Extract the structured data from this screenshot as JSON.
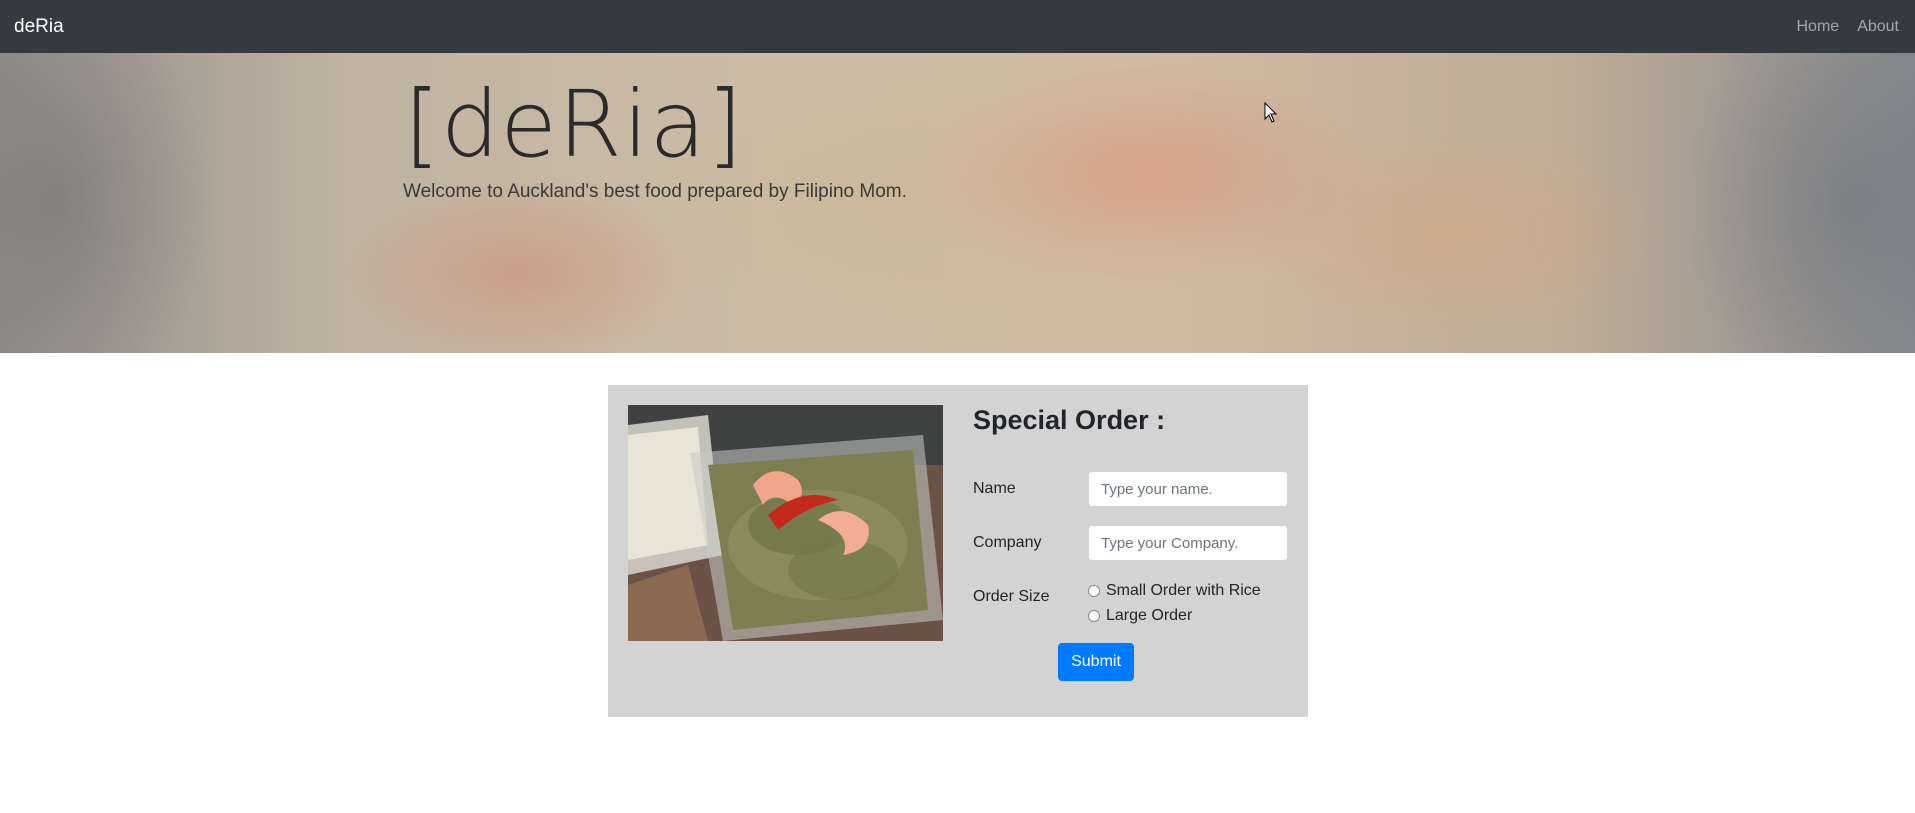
{
  "navbar": {
    "brand": "deRia",
    "links": [
      {
        "label": "Home"
      },
      {
        "label": "About"
      }
    ]
  },
  "hero": {
    "title": "[deRia]",
    "subtitle": "Welcome to Auckland's best food prepared by Filipino Mom."
  },
  "order_form": {
    "title": "Special Order :",
    "name": {
      "label": "Name",
      "placeholder": "Type your name."
    },
    "company": {
      "label": "Company",
      "placeholder": "Type your Company."
    },
    "order_size": {
      "label": "Order Size",
      "options": [
        {
          "label": "Small Order with Rice"
        },
        {
          "label": "Large Order"
        }
      ]
    },
    "submit_label": "Submit"
  },
  "colors": {
    "navbar": "#343a40",
    "card": "#d3d3d3",
    "primary": "#007bff"
  }
}
